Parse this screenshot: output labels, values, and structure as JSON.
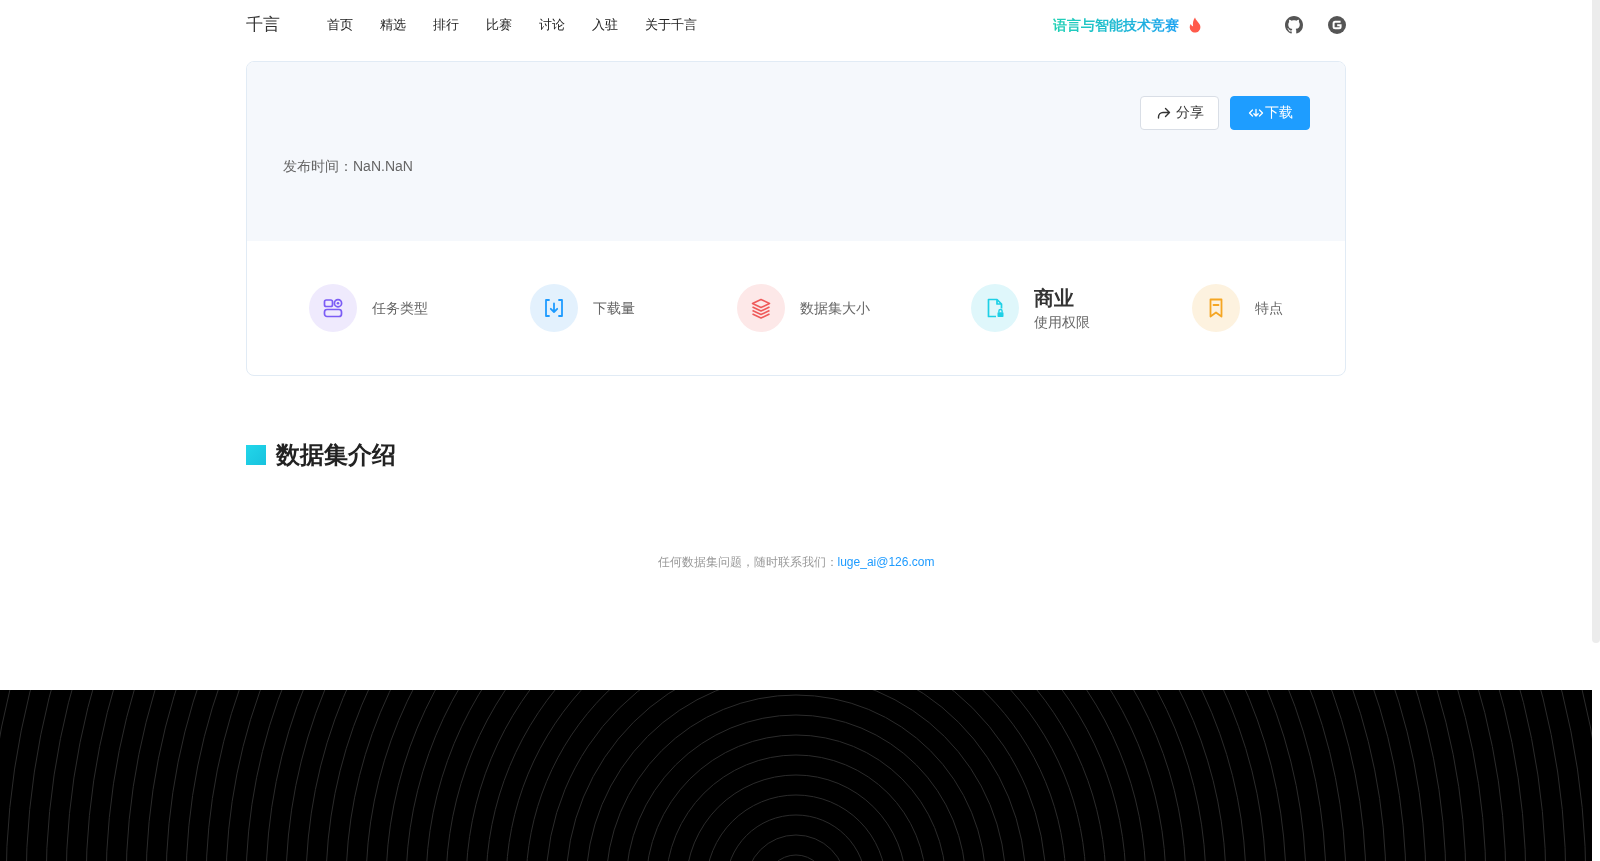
{
  "header": {
    "logo": "千言",
    "nav": [
      {
        "label": "首页"
      },
      {
        "label": "精选"
      },
      {
        "label": "排行"
      },
      {
        "label": "比赛"
      },
      {
        "label": "讨论"
      },
      {
        "label": "入驻"
      },
      {
        "label": "关于千言"
      }
    ],
    "promo": {
      "label": "语言与智能技术竞赛"
    },
    "links": [
      {
        "kind": "cat"
      },
      {
        "kind": "g"
      }
    ]
  },
  "dataset_card": {
    "actions": [
      {
        "kind": "share",
        "label": "分享"
      },
      {
        "kind": "download",
        "label": "下载"
      }
    ],
    "publish_time": "发布时间：NaN.NaN",
    "stats": [
      {
        "kind": "task_type",
        "label": "任务类型"
      },
      {
        "kind": "downloads",
        "label": "下载量"
      },
      {
        "kind": "size",
        "label": "数据集大小"
      },
      {
        "kind": "license",
        "value": "商业",
        "label": "使用权限"
      },
      {
        "kind": "features",
        "label": "特点"
      }
    ]
  },
  "section": {
    "title": "数据集介绍"
  },
  "contact": {
    "text": "任何数据集问题，随时联系我们：",
    "email": "luge_ai@126.com"
  }
}
